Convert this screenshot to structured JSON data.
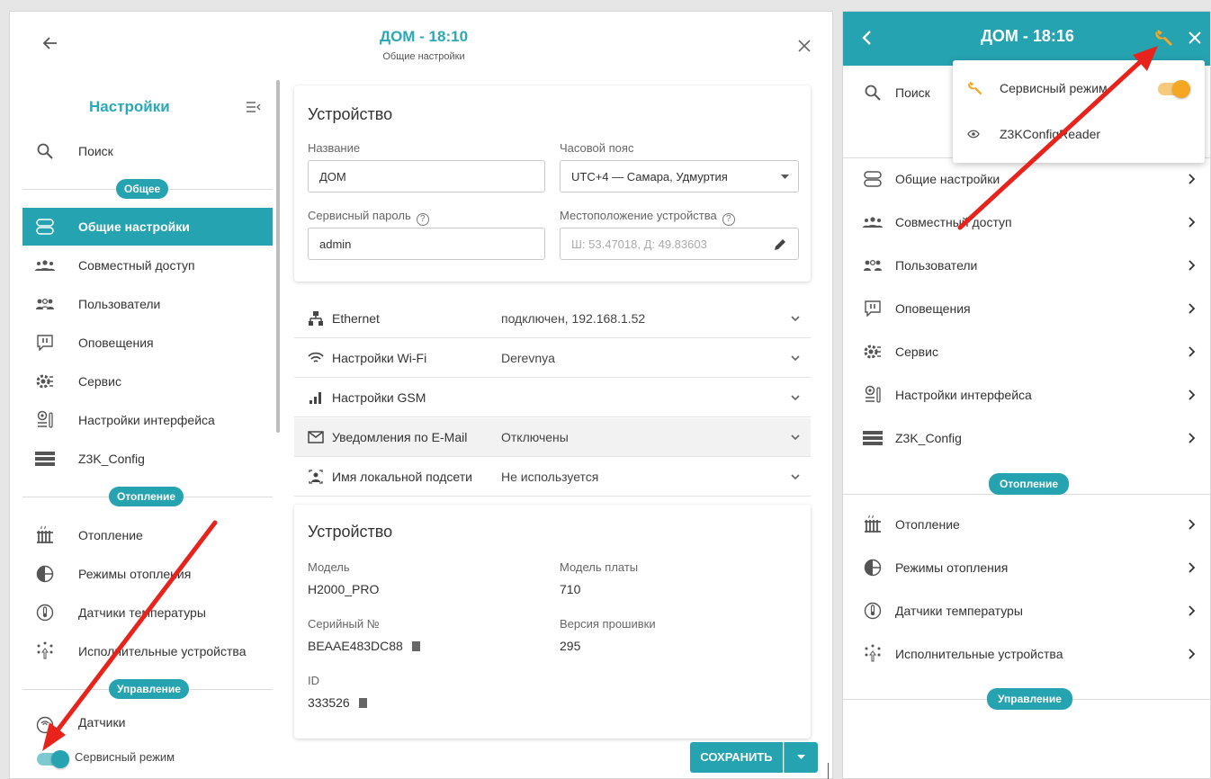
{
  "left": {
    "title": "ДОМ - 18:10",
    "subtitle": "Общие настройки",
    "sidebar": {
      "title": "Настройки",
      "search_label": "Поиск",
      "sections": [
        "Общее",
        "Отопление",
        "Управление"
      ],
      "items": [
        {
          "label": "Общие настройки",
          "icon": "io-icon"
        },
        {
          "label": "Совместный доступ",
          "icon": "share-access-icon"
        },
        {
          "label": "Пользователи",
          "icon": "users-icon"
        },
        {
          "label": "Оповещения",
          "icon": "alert-icon"
        },
        {
          "label": "Сервис",
          "icon": "gears-icon"
        },
        {
          "label": "Настройки интерфейса",
          "icon": "interface-icon"
        },
        {
          "label": "Z3K_Config",
          "icon": "config-icon"
        },
        {
          "label": "Отопление",
          "icon": "radiator-icon"
        },
        {
          "label": "Режимы отопления",
          "icon": "heating-modes-icon"
        },
        {
          "label": "Датчики температуры",
          "icon": "thermometer-icon"
        },
        {
          "label": "Исполнительные устройства",
          "icon": "actuators-icon"
        },
        {
          "label": "Датчики",
          "icon": "sensor-icon"
        }
      ],
      "service_mode_label": "Сервисный режим"
    },
    "device_card": {
      "title": "Устройство",
      "name_label": "Название",
      "name_value": "ДОМ",
      "timezone_label": "Часовой пояс",
      "timezone_value": "UTC+4 — Самара, Удмуртия",
      "password_label": "Сервисный пароль",
      "password_value": "admin",
      "location_label": "Местоположение устройства",
      "location_placeholder": "Ш: 53.47018, Д: 49.83603"
    },
    "accordion": [
      {
        "title": "Ethernet",
        "value": "подключен, 192.168.1.52",
        "icon": "ethernet-icon"
      },
      {
        "title": "Настройки Wi-Fi",
        "value": "Derevnya",
        "icon": "wifi-icon"
      },
      {
        "title": "Настройки GSM",
        "value": "",
        "icon": "signal-icon"
      },
      {
        "title": "Уведомления по E-Mail",
        "value": "Отключены",
        "icon": "mail-icon"
      },
      {
        "title": "Имя локальной подсети",
        "value": "Не используется",
        "icon": "subnet-icon"
      }
    ],
    "info_card": {
      "title": "Устройство",
      "model_label": "Модель",
      "model_value": "H2000_PRO",
      "board_label": "Модель платы",
      "board_value": "710",
      "serial_label": "Серийный №",
      "serial_value": "BEAAE483DC88",
      "fw_label": "Версия прошивки",
      "fw_value": "295",
      "id_label": "ID",
      "id_value": "333526"
    },
    "save_label": "СОХРАНИТЬ"
  },
  "right": {
    "title": "ДОМ - 18:16",
    "search_label": "Поиск",
    "menu": [
      {
        "label": "Сервисный режим",
        "icon": "wrench-icon"
      },
      {
        "label": "Z3KConfigReader",
        "icon": "eye-icon"
      }
    ],
    "items": [
      {
        "label": "Общие настройки",
        "icon": "io-icon"
      },
      {
        "label": "Совместный доступ",
        "icon": "share-access-icon"
      },
      {
        "label": "Пользователи",
        "icon": "users-icon"
      },
      {
        "label": "Оповещения",
        "icon": "alert-icon"
      },
      {
        "label": "Сервис",
        "icon": "gears-icon"
      },
      {
        "label": "Настройки интерфейса",
        "icon": "interface-icon"
      },
      {
        "label": "Z3K_Config",
        "icon": "config-icon"
      },
      {
        "label": "Отопление",
        "icon": "radiator-icon"
      },
      {
        "label": "Режимы отопления",
        "icon": "heating-modes-icon"
      },
      {
        "label": "Датчики температуры",
        "icon": "thermometer-icon"
      },
      {
        "label": "Исполнительные устройства",
        "icon": "actuators-icon"
      }
    ],
    "sections": [
      "Отопление",
      "Управление"
    ]
  },
  "colors": {
    "accent": "#26a3b0",
    "title": "#2aa8b8",
    "toggle_on": "#f5a623",
    "toggle_track": "#f7c97d",
    "arrow": "#e8231c"
  }
}
